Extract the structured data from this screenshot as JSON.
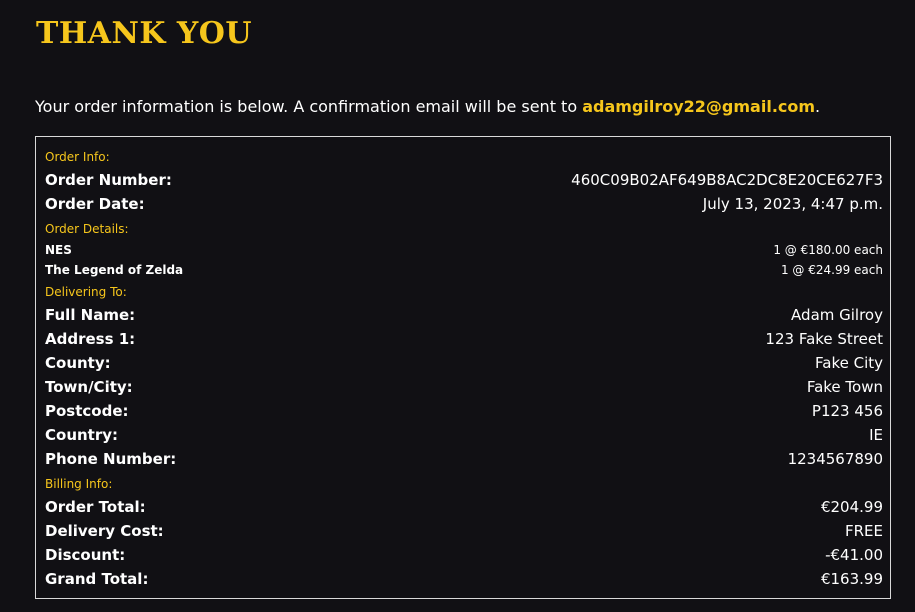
{
  "title": "THANK YOU",
  "intro": {
    "text": "Your order information is below. A confirmation email will be sent to ",
    "email": "adamgilroy22@gmail.com",
    "suffix": "."
  },
  "order_info": {
    "label": "Order Info:",
    "number_key": "Order Number:",
    "number_value": "460C09B02AF649B8AC2DC8E20CE627F3",
    "date_key": "Order Date:",
    "date_value": "July 13, 2023, 4:47 p.m."
  },
  "order_details": {
    "label": "Order Details:",
    "items": [
      {
        "name": "NES",
        "qty_price": "1 @ €180.00 each"
      },
      {
        "name": "The Legend of Zelda",
        "qty_price": "1 @ €24.99 each"
      }
    ]
  },
  "delivering": {
    "label": "Delivering To:",
    "fields": [
      {
        "key": "Full Name:",
        "value": "Adam Gilroy"
      },
      {
        "key": "Address 1:",
        "value": "123 Fake Street"
      },
      {
        "key": "County:",
        "value": "Fake City"
      },
      {
        "key": "Town/City:",
        "value": "Fake Town"
      },
      {
        "key": "Postcode:",
        "value": "P123 456"
      },
      {
        "key": "Country:",
        "value": "IE"
      },
      {
        "key": "Phone Number:",
        "value": "1234567890"
      }
    ]
  },
  "billing": {
    "label": "Billing Info:",
    "fields": [
      {
        "key": "Order Total:",
        "value": "€204.99"
      },
      {
        "key": "Delivery Cost:",
        "value": "FREE"
      },
      {
        "key": "Discount:",
        "value": "-€41.00"
      },
      {
        "key": "Grand Total:",
        "value": "€163.99"
      }
    ]
  },
  "colors": {
    "accent": "#f6c61c",
    "background": "#111014",
    "border": "#d9d9d9"
  }
}
